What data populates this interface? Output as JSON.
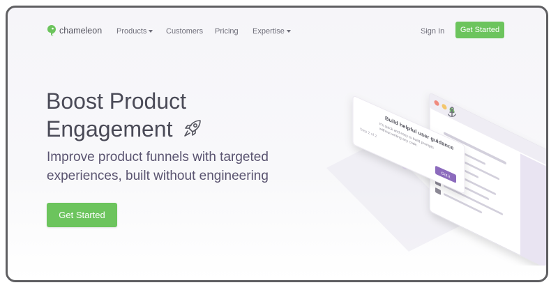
{
  "nav": {
    "brand": "chameleon",
    "items": [
      {
        "label": "Products",
        "dropdown": true
      },
      {
        "label": "Customers",
        "dropdown": false
      },
      {
        "label": "Pricing",
        "dropdown": false
      },
      {
        "label": "Expertise",
        "dropdown": true
      }
    ],
    "sign_in": "Sign In",
    "cta": "Get Started"
  },
  "hero": {
    "headline_line1": "Boost Product",
    "headline_line2": "Engagement",
    "subheadline_line1": "Improve product funnels with targeted",
    "subheadline_line2": "experiences, built without engineering",
    "cta": "Get Started"
  },
  "illustration": {
    "tooltip_title": "Build helpful user guidance",
    "tooltip_body_line1": "It's quick and easy to build prompts",
    "tooltip_body_line2": "without writing any code.",
    "tooltip_step": "Step 2 of 2",
    "tooltip_button": "Got it"
  },
  "colors": {
    "accent_green": "#6cc45d",
    "brand_purple": "#7b5ea7",
    "text_dark": "#4a4a57"
  },
  "icons": [
    "chameleon-logo-icon",
    "chevron-down-icon",
    "rocket-icon",
    "anchor-icon"
  ]
}
